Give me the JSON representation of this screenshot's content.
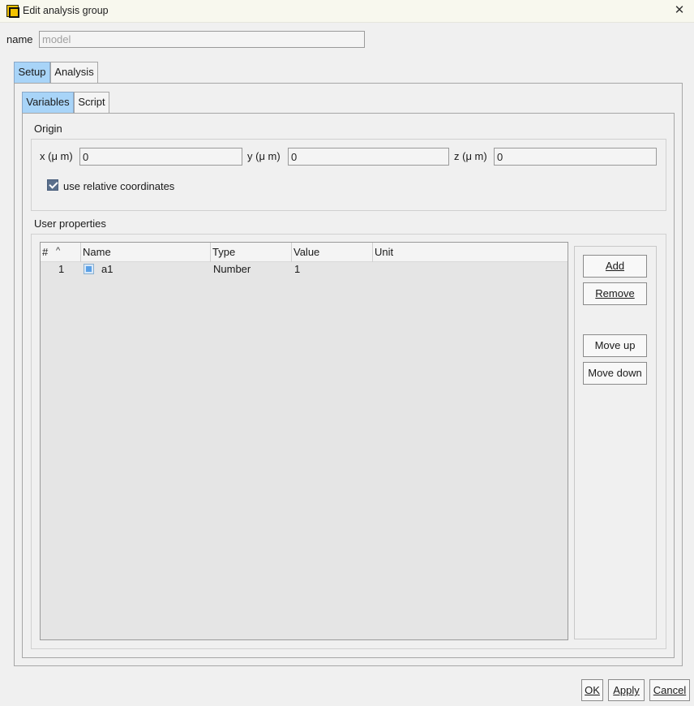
{
  "window": {
    "title": "Edit analysis group"
  },
  "name_field": {
    "label": "name",
    "value": "model"
  },
  "top_tabs": [
    {
      "label": "Setup",
      "active": true
    },
    {
      "label": "Analysis",
      "active": false
    }
  ],
  "inner_tabs": [
    {
      "label": "Variables",
      "active": true
    },
    {
      "label": "Script",
      "active": false
    }
  ],
  "origin": {
    "section_label": "Origin",
    "x": {
      "label": "x (μ m)",
      "value": "0"
    },
    "y": {
      "label": "y (μ m)",
      "value": "0"
    },
    "z": {
      "label": "z (μ m)",
      "value": "0"
    },
    "relative_coords": {
      "label": "use relative coordinates",
      "checked": true
    }
  },
  "user_properties": {
    "section_label": "User properties",
    "columns": [
      "#",
      "Name",
      "Type",
      "Value",
      "Unit"
    ],
    "rows": [
      {
        "num": "1",
        "name": "a1",
        "type": "Number",
        "value": "1",
        "unit": ""
      }
    ],
    "buttons": {
      "add": "Add",
      "remove": "Remove",
      "move_up": "Move up",
      "move_down": "Move down"
    }
  },
  "footer": {
    "ok": "OK",
    "apply": "Apply",
    "cancel": "Cancel"
  }
}
